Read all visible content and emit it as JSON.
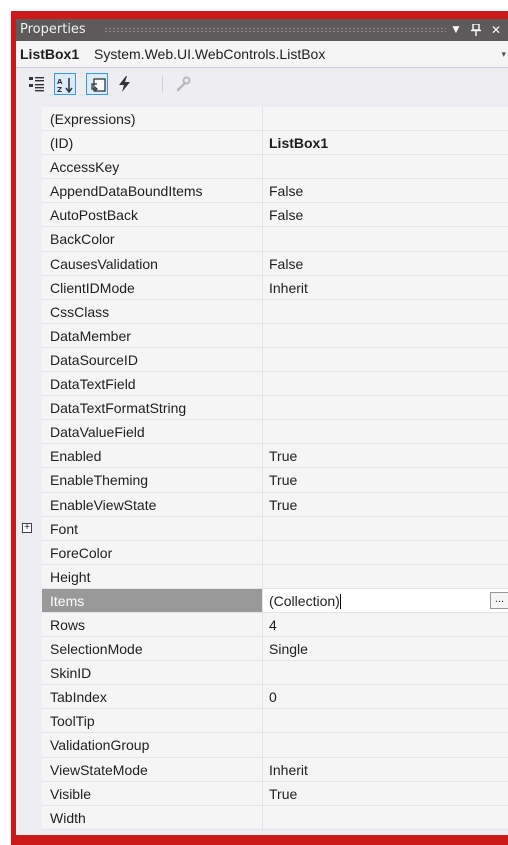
{
  "window": {
    "title": "Properties",
    "pin_glyph": "Ȩ",
    "dropdown_glyph": "▼",
    "close_glyph": "✕"
  },
  "object_selector": {
    "name": "ListBox1",
    "type": "System.Web.UI.WebControls.ListBox",
    "arrow": "▾"
  },
  "toolbar": {
    "tools": [
      {
        "name": "categorized-icon",
        "active": false
      },
      {
        "name": "alphabetical-icon",
        "active": true
      },
      {
        "name": "properties-icon",
        "active": true
      },
      {
        "name": "events-icon",
        "active": false
      },
      {
        "name": "property-pages-icon",
        "active": false
      }
    ]
  },
  "properties": [
    {
      "name": "(Expressions)",
      "value": ""
    },
    {
      "name": "(ID)",
      "value": "ListBox1",
      "bold": true
    },
    {
      "name": "AccessKey",
      "value": ""
    },
    {
      "name": "AppendDataBoundItems",
      "value": "False"
    },
    {
      "name": "AutoPostBack",
      "value": "False"
    },
    {
      "name": "BackColor",
      "value": ""
    },
    {
      "name": "CausesValidation",
      "value": "False"
    },
    {
      "name": "ClientIDMode",
      "value": "Inherit"
    },
    {
      "name": "CssClass",
      "value": ""
    },
    {
      "name": "DataMember",
      "value": ""
    },
    {
      "name": "DataSourceID",
      "value": ""
    },
    {
      "name": "DataTextField",
      "value": ""
    },
    {
      "name": "DataTextFormatString",
      "value": ""
    },
    {
      "name": "DataValueField",
      "value": ""
    },
    {
      "name": "Enabled",
      "value": "True"
    },
    {
      "name": "EnableTheming",
      "value": "True"
    },
    {
      "name": "EnableViewState",
      "value": "True"
    },
    {
      "name": "Font",
      "value": "",
      "expandable": true,
      "expander_glyph": "+"
    },
    {
      "name": "ForeColor",
      "value": ""
    },
    {
      "name": "Height",
      "value": ""
    },
    {
      "name": "Items",
      "value": "(Collection)",
      "selected": true,
      "ellipsis": "..."
    },
    {
      "name": "Rows",
      "value": "4"
    },
    {
      "name": "SelectionMode",
      "value": "Single"
    },
    {
      "name": "SkinID",
      "value": ""
    },
    {
      "name": "TabIndex",
      "value": "0"
    },
    {
      "name": "ToolTip",
      "value": ""
    },
    {
      "name": "ValidationGroup",
      "value": ""
    },
    {
      "name": "ViewStateMode",
      "value": "Inherit"
    },
    {
      "name": "Visible",
      "value": "True"
    },
    {
      "name": "Width",
      "value": ""
    }
  ],
  "colors": {
    "frame_border": "#cc1a1a",
    "titlebar": "#5c5a5a",
    "selected_row": "#999999",
    "grid_bg": "#f5f5f5"
  }
}
